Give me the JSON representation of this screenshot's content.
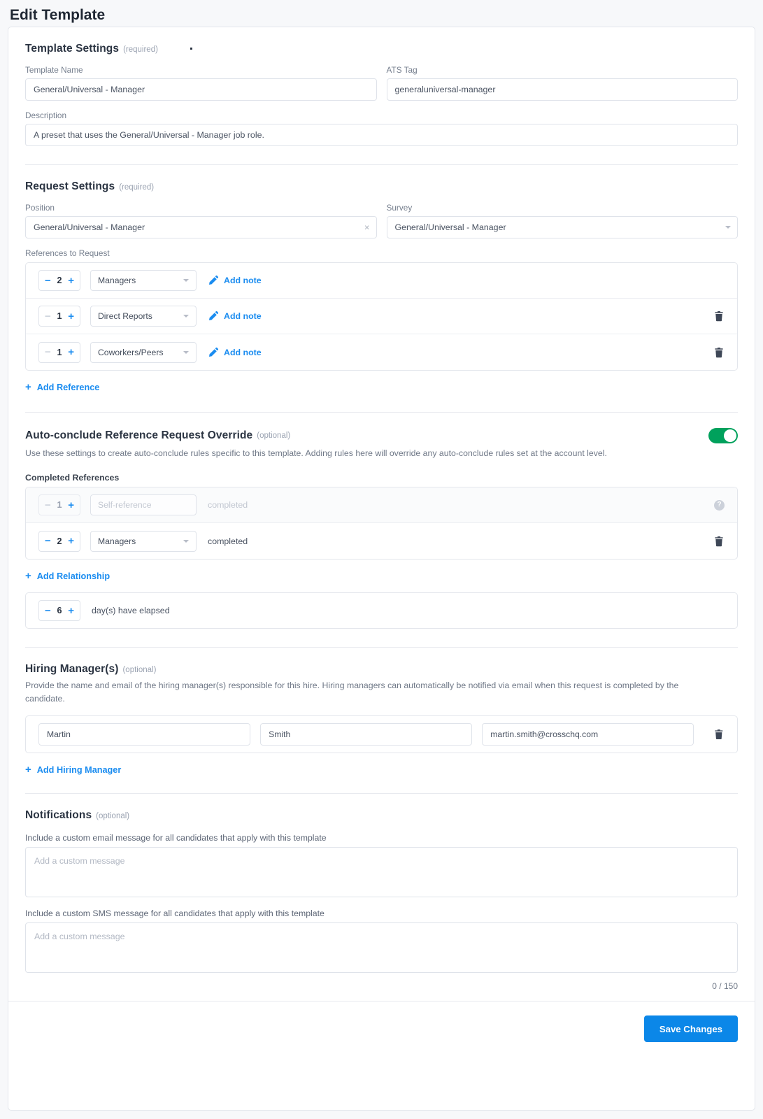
{
  "page": {
    "title": "Edit Template"
  },
  "template_settings": {
    "heading": "Template Settings",
    "required_tag": "(required)",
    "name_label": "Template Name",
    "name_value": "General/Universal - Manager",
    "ats_label": "ATS Tag",
    "ats_value": "generaluniversal-manager",
    "description_label": "Description",
    "description_value": "A preset that uses the General/Universal - Manager job role."
  },
  "request_settings": {
    "heading": "Request Settings",
    "required_tag": "(required)",
    "position_label": "Position",
    "position_value": "General/Universal - Manager",
    "position_clear": "×",
    "survey_label": "Survey",
    "survey_value": "General/Universal - Manager",
    "references_label": "References to Request",
    "rows": [
      {
        "count": "2",
        "relationship": "Managers",
        "note_label": "Add note",
        "minus_enabled": true,
        "deletable": false
      },
      {
        "count": "1",
        "relationship": "Direct Reports",
        "note_label": "Add note",
        "minus_enabled": false,
        "deletable": true
      },
      {
        "count": "1",
        "relationship": "Coworkers/Peers",
        "note_label": "Add note",
        "minus_enabled": false,
        "deletable": true
      }
    ],
    "add_reference_label": "Add Reference"
  },
  "auto_conclude": {
    "heading": "Auto-conclude Reference Request Override",
    "optional_tag": "(optional)",
    "description": "Use these settings to create auto-conclude rules specific to this template. Adding rules here will override any auto-conclude rules set at the account level.",
    "toggle_on": true,
    "completed_label": "Completed References",
    "rows": [
      {
        "count": "1",
        "relationship": "Self-reference",
        "suffix": "completed",
        "disabled": true,
        "has_help": true
      },
      {
        "count": "2",
        "relationship": "Managers",
        "suffix": "completed",
        "disabled": false,
        "has_help": false
      }
    ],
    "add_relationship_label": "Add Relationship",
    "elapsed_count": "6",
    "elapsed_label": "day(s) have elapsed"
  },
  "hiring_managers": {
    "heading": "Hiring Manager(s)",
    "optional_tag": "(optional)",
    "description": "Provide the name and email of the hiring manager(s) responsible for this hire. Hiring managers can automatically be notified via email when this request is completed by the candidate.",
    "rows": [
      {
        "first_name": "Martin",
        "last_name": "Smith",
        "email": "martin.smith@crosschq.com"
      }
    ],
    "add_label": "Add Hiring Manager"
  },
  "notifications": {
    "heading": "Notifications",
    "optional_tag": "(optional)",
    "email_label": "Include a custom email message for all candidates that apply with this template",
    "email_placeholder": "Add a custom message",
    "sms_label": "Include a custom SMS message for all candidates that apply with this template",
    "sms_placeholder": "Add a custom message",
    "counter": "0 / 150"
  },
  "footer": {
    "save_label": "Save Changes"
  },
  "colors": {
    "accent_blue": "#1a8cf0",
    "button_blue": "#0b87e8",
    "toggle_green": "#00a15c",
    "text_dark": "#2b3442",
    "text_muted": "#6f7887"
  }
}
